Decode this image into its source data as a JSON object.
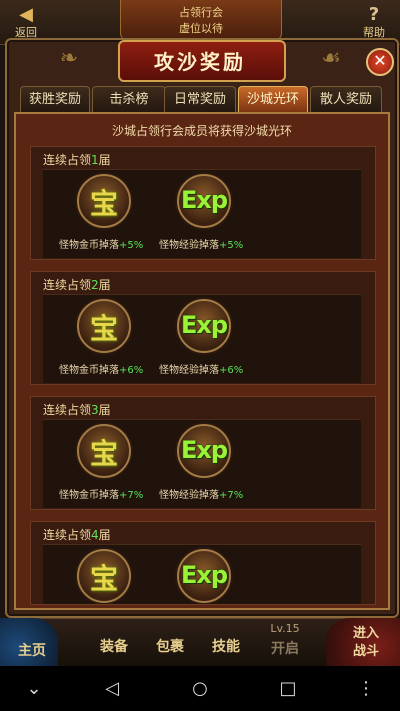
{
  "header": {
    "back_label": "返回",
    "help_label": "帮助",
    "top_title_line1": "占领行会",
    "top_title_line2": "虚位以待"
  },
  "dialog": {
    "title": "攻沙奖励",
    "close_symbol": "✕"
  },
  "tabs": [
    {
      "label": "获胜奖励",
      "active": false
    },
    {
      "label": "击杀榜",
      "active": false
    },
    {
      "label": "日常奖励",
      "active": false
    },
    {
      "label": "沙城光环",
      "active": true
    },
    {
      "label": "散人奖励",
      "active": false
    }
  ],
  "content": {
    "subtitle": "沙城占领行会成员将获得沙城光环",
    "rewards": [
      {
        "label_prefix": "连续占领",
        "count": "1",
        "label_suffix": "届",
        "gold_caption": "怪物金币掉落",
        "gold_pct": "+5%",
        "exp_caption": "怪物经验掉落",
        "exp_pct": "+5%"
      },
      {
        "label_prefix": "连续占领",
        "count": "2",
        "label_suffix": "届",
        "gold_caption": "怪物金币掉落",
        "gold_pct": "+6%",
        "exp_caption": "怪物经验掉落",
        "exp_pct": "+6%"
      },
      {
        "label_prefix": "连续占领",
        "count": "3",
        "label_suffix": "届",
        "gold_caption": "怪物金币掉落",
        "gold_pct": "+7%",
        "exp_caption": "怪物经验掉落",
        "exp_pct": "+7%"
      },
      {
        "label_prefix": "连续占领",
        "count": "4",
        "label_suffix": "届"
      }
    ],
    "gold_glyph": "宝",
    "exp_glyph": "Exp"
  },
  "bottom_nav": {
    "home": "主页",
    "equip": "装备",
    "bag": "包裹",
    "skill": "技能",
    "level": "Lv.15",
    "level_sub": "开启",
    "battle_line1": "进入",
    "battle_line2": "战斗"
  },
  "system_bar": {
    "icons": [
      "chevron-down-icon",
      "back-triangle-icon",
      "home-circle-icon",
      "recents-square-icon",
      "more-dots-icon"
    ]
  }
}
